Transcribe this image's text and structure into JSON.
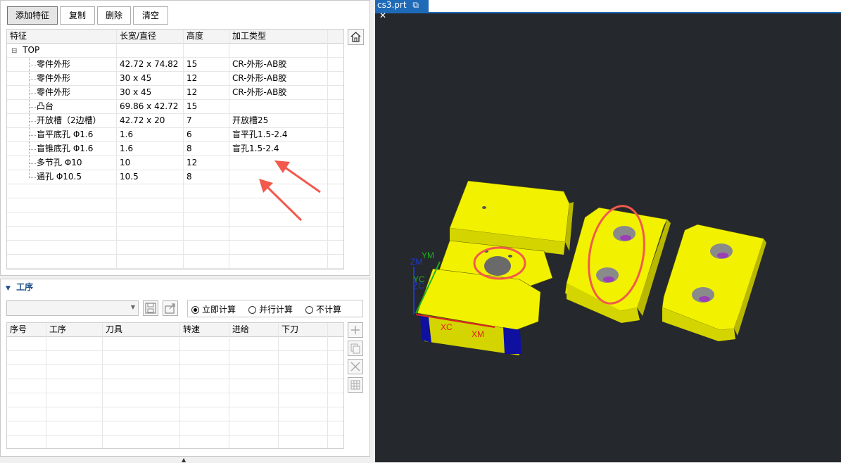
{
  "toolbar": {
    "add_feature": "添加特征",
    "copy": "复制",
    "delete": "删除",
    "clear": "清空"
  },
  "feature_table": {
    "headers": [
      "特征",
      "长宽/直径",
      "高度",
      "加工类型"
    ],
    "root": {
      "toggle": "⊟",
      "label": "TOP"
    },
    "rows": [
      {
        "name": "零件外形",
        "size": "42.72 x 74.82",
        "height": "15",
        "type": "CR-外形-AB胶"
      },
      {
        "name": "零件外形",
        "size": "30 x 45",
        "height": "12",
        "type": "CR-外形-AB胶"
      },
      {
        "name": "零件外形",
        "size": "30 x 45",
        "height": "12",
        "type": "CR-外形-AB胶"
      },
      {
        "name": "凸台",
        "size": "69.86 x 42.72",
        "height": "15",
        "type": ""
      },
      {
        "name": "开放槽（2边槽）",
        "size": "42.72 x 20",
        "height": "7",
        "type": "开放槽25"
      },
      {
        "name": "盲平底孔 Φ1.6",
        "size": "1.6",
        "height": "6",
        "type": "盲平孔1.5-2.4"
      },
      {
        "name": "盲锥底孔 Φ1.6",
        "size": "1.6",
        "height": "8",
        "type": "盲孔1.5-2.4"
      },
      {
        "name": "多节孔 Φ10",
        "size": "10",
        "height": "12",
        "type": ""
      },
      {
        "name": "通孔 Φ10.5",
        "size": "10.5",
        "height": "8",
        "type": ""
      }
    ]
  },
  "process": {
    "section_title": "工序",
    "radios": [
      {
        "label": "立即计算",
        "checked": true
      },
      {
        "label": "并行计算",
        "checked": false
      },
      {
        "label": "不计算",
        "checked": false
      }
    ],
    "headers": [
      "序号",
      "工序",
      "刀具",
      "转速",
      "进给",
      "下刀"
    ]
  },
  "viewport": {
    "tab_title": "cs3.prt",
    "axes": {
      "ym": "YM",
      "zm": "ZM",
      "yc": "YC",
      "zc": "ZC",
      "xc": "XC",
      "xm": "XM"
    }
  },
  "colors": {
    "part": "#f2f200",
    "background": "#25282c",
    "annotation": "#f15a4d",
    "tab": "#1e6ab7"
  }
}
